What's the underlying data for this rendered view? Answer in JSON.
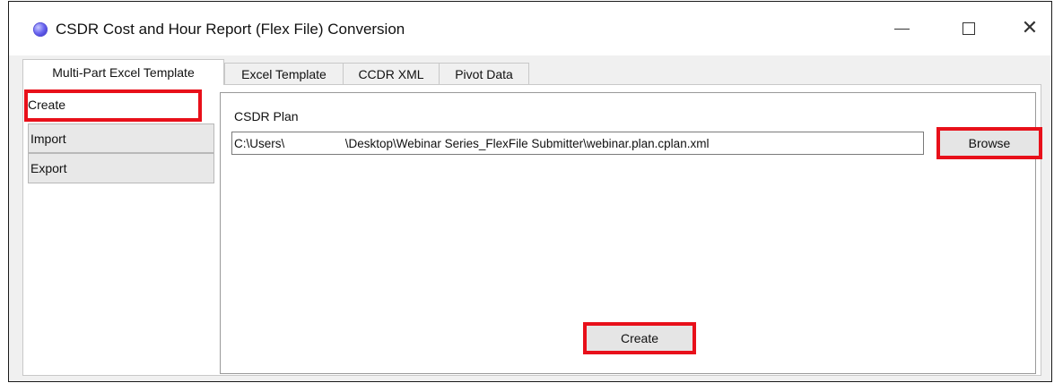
{
  "window": {
    "title": "CSDR Cost and Hour Report (Flex File) Conversion",
    "icon": "app-globe-icon",
    "controls": {
      "minimize": "minimize-icon",
      "maximize": "maximize-icon",
      "close": "close-icon"
    }
  },
  "tabs": [
    {
      "label": "Multi-Part Excel Template",
      "active": true
    },
    {
      "label": "Excel Template",
      "active": false
    },
    {
      "label": "CCDR XML",
      "active": false
    },
    {
      "label": "Pivot Data",
      "active": false
    }
  ],
  "side_nav": {
    "items": [
      {
        "label": "Create",
        "selected": true
      },
      {
        "label": "Import",
        "selected": false
      },
      {
        "label": "Export",
        "selected": false
      }
    ]
  },
  "create_panel": {
    "plan_label": "CSDR Plan",
    "plan_path": "C:\\Users\\                  \\Desktop\\Webinar Series_FlexFile Submitter\\webinar.plan.cplan.xml",
    "browse_label": "Browse",
    "create_label": "Create"
  },
  "colors": {
    "highlight": "#e8101a",
    "window_bg": "#f0f0f0",
    "button_bg": "#e5e5e5"
  }
}
